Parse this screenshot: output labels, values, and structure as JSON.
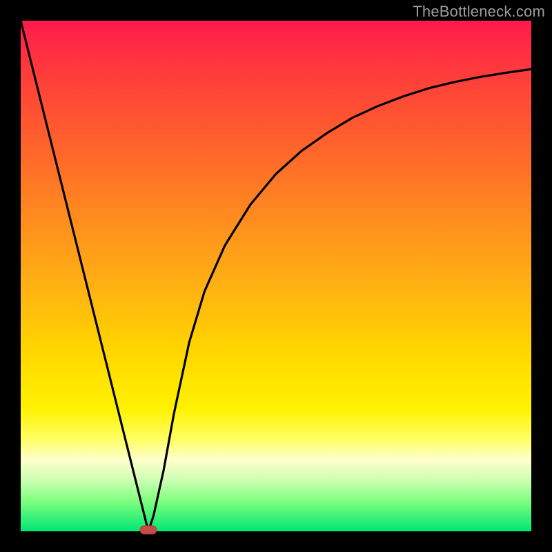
{
  "watermark": "TheBottleneck.com",
  "chart_data": {
    "type": "line",
    "title": "",
    "xlabel": "",
    "ylabel": "",
    "xlim": [
      0,
      100
    ],
    "ylim": [
      0,
      100
    ],
    "series": [
      {
        "name": "bottleneck-curve",
        "x": [
          0,
          5,
          10,
          15,
          20,
          22,
          24,
          25,
          26,
          28,
          30,
          33,
          36,
          40,
          45,
          50,
          55,
          60,
          65,
          70,
          75,
          80,
          85,
          90,
          95,
          100
        ],
        "y": [
          100,
          80,
          60,
          40,
          20,
          12,
          4,
          0,
          3,
          12,
          23,
          37,
          47,
          56,
          64,
          70,
          74.5,
          78,
          81,
          83.3,
          85.2,
          86.8,
          88,
          89,
          89.8,
          90.5
        ]
      }
    ],
    "marker": {
      "x": 25,
      "y": 0,
      "label": "optimal-point"
    },
    "background_gradient": {
      "stops": [
        {
          "pos": 0,
          "color": "#ff1a4d"
        },
        {
          "pos": 10,
          "color": "#ff3b3b"
        },
        {
          "pos": 22,
          "color": "#ff5c2e"
        },
        {
          "pos": 38,
          "color": "#ff8a1f"
        },
        {
          "pos": 52,
          "color": "#ffb112"
        },
        {
          "pos": 64,
          "color": "#ffd400"
        },
        {
          "pos": 76,
          "color": "#fff200"
        },
        {
          "pos": 82,
          "color": "#ffff66"
        },
        {
          "pos": 86,
          "color": "#ffffcc"
        },
        {
          "pos": 90,
          "color": "#ccffb3"
        },
        {
          "pos": 94,
          "color": "#80ff80"
        },
        {
          "pos": 100,
          "color": "#00e673"
        }
      ]
    }
  }
}
